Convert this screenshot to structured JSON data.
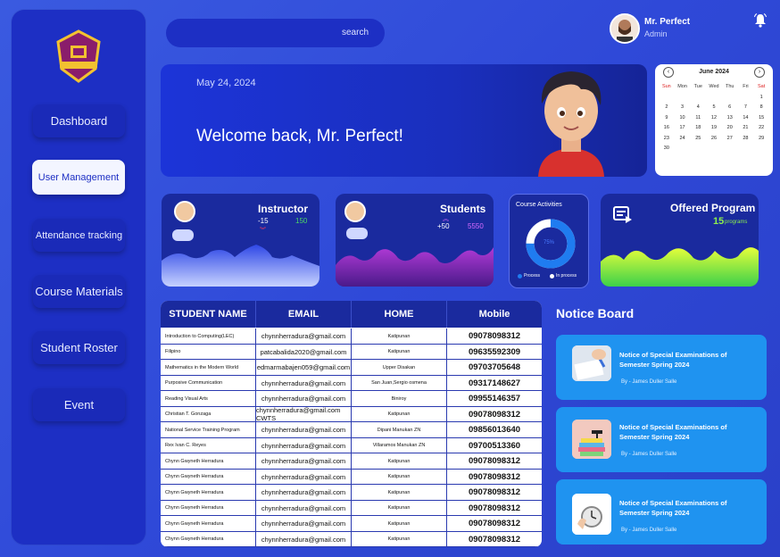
{
  "sidebar": {
    "nav": [
      {
        "label": "Dashboard"
      },
      {
        "label": "User Management"
      },
      {
        "label": "Attendance tracking"
      },
      {
        "label": "Course Materials"
      },
      {
        "label": "Student Roster"
      },
      {
        "label": "Event"
      }
    ]
  },
  "search": {
    "label": "search"
  },
  "user": {
    "name": "Mr. Perfect",
    "role": "Admin"
  },
  "banner": {
    "date": "May 24, 2024",
    "welcome": "Welcome back, Mr. Perfect!"
  },
  "calendar": {
    "title": "June 2024",
    "weekdays": [
      "Sun",
      "Mon",
      "Tue",
      "Wed",
      "Thu",
      "Fri",
      "Sat"
    ],
    "days": [
      "",
      "",
      "",
      "",
      "",
      "",
      "1",
      "2",
      "3",
      "4",
      "5",
      "6",
      "7",
      "8",
      "9",
      "10",
      "11",
      "12",
      "13",
      "14",
      "15",
      "16",
      "17",
      "18",
      "19",
      "20",
      "21",
      "22",
      "23",
      "24",
      "25",
      "26",
      "27",
      "28",
      "29",
      "30"
    ]
  },
  "cards": {
    "instructor": {
      "title": "Instructor",
      "delta": "-15",
      "count": "150"
    },
    "students": {
      "title": "Students",
      "delta": "+50",
      "count": "5550"
    },
    "course": {
      "title": "Course Activities",
      "percent": "75%",
      "legend_a": "Process",
      "legend_b": "In process"
    },
    "program": {
      "title": "Offered Program",
      "count": "15",
      "unit": "programs"
    }
  },
  "table": {
    "headers": [
      "STUDENT NAME",
      "EMAIL",
      "HOME",
      "Mobile"
    ],
    "rows": [
      [
        "Introduction to Computing(LEC)",
        "chynnherradura@gmail.com",
        "Katipunan",
        "09078098312"
      ],
      [
        "Filipino",
        "patcabalida2020@gmail.com",
        "Katipunan",
        "09635592309"
      ],
      [
        "Mathematics in the Modern World",
        "edmarmabajen059@gmail.com",
        "Upper Disakan",
        "09703705648"
      ],
      [
        "Purposive Communication",
        "chynnherradura@gmail.com",
        "San Juan,Sergio osmena",
        "09317148627"
      ],
      [
        "Reading Visual Arts",
        "chynnherradura@gmail.com",
        "Biniroy",
        "09955146357"
      ],
      [
        "Christian T. Gonzaga",
        "chynnherradura@gmail.com CWTS",
        "Katipunan",
        "09078098312"
      ],
      [
        "National Service Training Program",
        "chynnherradura@gmail.com",
        "Dipani Manukan ZN",
        "09856013640"
      ],
      [
        "Rex Ivan C. Reyes",
        "chynnherradura@gmail.com",
        "Villaramos Manukan ZN",
        "09700513360"
      ],
      [
        "Chynn Gwyneth Herradura",
        "chynnherradura@gmail.com",
        "Katipunan",
        "09078098312"
      ],
      [
        "Chynn Gwyneth Herradura",
        "chynnherradura@gmail.com",
        "Katipunan",
        "09078098312"
      ],
      [
        "Chynn Gwyneth Herradura",
        "chynnherradura@gmail.com",
        "Katipunan",
        "09078098312"
      ],
      [
        "Chynn Gwyneth Herradura",
        "chynnherradura@gmail.com",
        "Katipunan",
        "09078098312"
      ],
      [
        "Chynn Gwyneth Herradura",
        "chynnherradura@gmail.com",
        "Katipunan",
        "09078098312"
      ],
      [
        "Chynn Gwyneth Herradura",
        "chynnherradura@gmail.com",
        "Katipunan",
        "09078098312"
      ]
    ]
  },
  "notice_board": {
    "title": "Notice Board",
    "items": [
      {
        "title": "Notice of Special Examinations of Semester Spring 2024",
        "by": "By - James Duller Salle"
      },
      {
        "title": "Notice of Special Examinations of Semester Spring 2024",
        "by": "By - James Duller Salle"
      },
      {
        "title": "Notice of Special Examinations of Semester Spring 2024",
        "by": "By - James Duller Salle"
      }
    ]
  },
  "colors": {
    "accent": "#1d2fc4",
    "notice": "#1f93f0",
    "positive": "#4cd964",
    "negative": "#ff3b5c"
  }
}
